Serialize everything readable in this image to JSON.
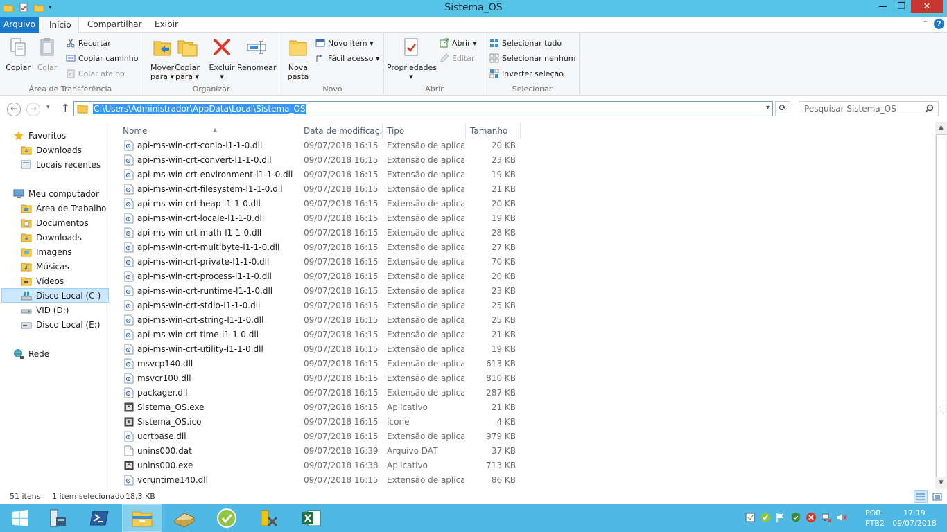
{
  "window": {
    "title": "Sistema_OS"
  },
  "tabs": [
    {
      "label": "Arquivo"
    },
    {
      "label": "Início"
    },
    {
      "label": "Compartilhar"
    },
    {
      "label": "Exibir"
    }
  ],
  "ribbon": {
    "clipboard": {
      "label": "Área de Transferência",
      "copy": "Copiar",
      "paste": "Colar",
      "cut": "Recortar",
      "copy_path": "Copiar caminho",
      "paste_shortcut": "Colar atalho"
    },
    "organize": {
      "label": "Organizar",
      "move_to_1": "Mover",
      "move_to_2": "para ▾",
      "copy_to_1": "Copiar",
      "copy_to_2": "para ▾",
      "delete_1": "Excluir",
      "delete_2": "▾",
      "rename": "Renomear"
    },
    "new": {
      "label": "Novo",
      "new_folder_1": "Nova",
      "new_folder_2": "pasta",
      "new_item": "Novo item ▾",
      "easy_access": "Fácil acesso ▾"
    },
    "open": {
      "label": "Abrir",
      "properties_1": "Propriedades",
      "properties_2": "▾",
      "open": "Abrir ▾",
      "edit": "Editar"
    },
    "select": {
      "label": "Selecionar",
      "select_all": "Selecionar tudo",
      "select_none": "Selecionar nenhum",
      "invert": "Inverter seleção"
    }
  },
  "address": {
    "path": "C:\\Users\\Administrador\\AppData\\Local\\Sistema_OS",
    "search_placeholder": "Pesquisar Sistema_OS"
  },
  "nav": {
    "favorites": "Favoritos",
    "downloads_fav": "Downloads",
    "recent": "Locais recentes",
    "computer": "Meu computador",
    "desktop": "Área de Trabalho",
    "documents": "Documentos",
    "downloads": "Downloads",
    "images": "Imagens",
    "music": "Músicas",
    "videos": "Vídeos",
    "disk_c": "Disco Local (C:)",
    "vid_d": "VID (D:)",
    "disk_e": "Disco Local (E:)",
    "network": "Rede"
  },
  "columns": {
    "name": "Nome",
    "date": "Data de modificaç...",
    "type": "Tipo",
    "size": "Tamanho"
  },
  "files": [
    {
      "name": "api-ms-win-crt-conio-l1-1-0.dll",
      "date": "09/07/2018 16:15",
      "type": "Extensão de aplica...",
      "size": "20 KB",
      "icon": "dll-icon"
    },
    {
      "name": "api-ms-win-crt-convert-l1-1-0.dll",
      "date": "09/07/2018 16:15",
      "type": "Extensão de aplica...",
      "size": "23 KB",
      "icon": "dll-icon"
    },
    {
      "name": "api-ms-win-crt-environment-l1-1-0.dll",
      "date": "09/07/2018 16:15",
      "type": "Extensão de aplica...",
      "size": "19 KB",
      "icon": "dll-icon"
    },
    {
      "name": "api-ms-win-crt-filesystem-l1-1-0.dll",
      "date": "09/07/2018 16:15",
      "type": "Extensão de aplica...",
      "size": "21 KB",
      "icon": "dll-icon"
    },
    {
      "name": "api-ms-win-crt-heap-l1-1-0.dll",
      "date": "09/07/2018 16:15",
      "type": "Extensão de aplica...",
      "size": "20 KB",
      "icon": "dll-icon"
    },
    {
      "name": "api-ms-win-crt-locale-l1-1-0.dll",
      "date": "09/07/2018 16:15",
      "type": "Extensão de aplica...",
      "size": "19 KB",
      "icon": "dll-icon"
    },
    {
      "name": "api-ms-win-crt-math-l1-1-0.dll",
      "date": "09/07/2018 16:15",
      "type": "Extensão de aplica...",
      "size": "28 KB",
      "icon": "dll-icon"
    },
    {
      "name": "api-ms-win-crt-multibyte-l1-1-0.dll",
      "date": "09/07/2018 16:15",
      "type": "Extensão de aplica...",
      "size": "27 KB",
      "icon": "dll-icon"
    },
    {
      "name": "api-ms-win-crt-private-l1-1-0.dll",
      "date": "09/07/2018 16:15",
      "type": "Extensão de aplica...",
      "size": "70 KB",
      "icon": "dll-icon"
    },
    {
      "name": "api-ms-win-crt-process-l1-1-0.dll",
      "date": "09/07/2018 16:15",
      "type": "Extensão de aplica...",
      "size": "20 KB",
      "icon": "dll-icon"
    },
    {
      "name": "api-ms-win-crt-runtime-l1-1-0.dll",
      "date": "09/07/2018 16:15",
      "type": "Extensão de aplica...",
      "size": "23 KB",
      "icon": "dll-icon"
    },
    {
      "name": "api-ms-win-crt-stdio-l1-1-0.dll",
      "date": "09/07/2018 16:15",
      "type": "Extensão de aplica...",
      "size": "25 KB",
      "icon": "dll-icon"
    },
    {
      "name": "api-ms-win-crt-string-l1-1-0.dll",
      "date": "09/07/2018 16:15",
      "type": "Extensão de aplica...",
      "size": "25 KB",
      "icon": "dll-icon"
    },
    {
      "name": "api-ms-win-crt-time-l1-1-0.dll",
      "date": "09/07/2018 16:15",
      "type": "Extensão de aplica...",
      "size": "21 KB",
      "icon": "dll-icon"
    },
    {
      "name": "api-ms-win-crt-utility-l1-1-0.dll",
      "date": "09/07/2018 16:15",
      "type": "Extensão de aplica...",
      "size": "19 KB",
      "icon": "dll-icon"
    },
    {
      "name": "msvcp140.dll",
      "date": "09/07/2018 16:15",
      "type": "Extensão de aplica...",
      "size": "613 KB",
      "icon": "dll-icon"
    },
    {
      "name": "msvcr100.dll",
      "date": "09/07/2018 16:15",
      "type": "Extensão de aplica...",
      "size": "810 KB",
      "icon": "dll-icon"
    },
    {
      "name": "packager.dll",
      "date": "09/07/2018 16:15",
      "type": "Extensão de aplica...",
      "size": "287 KB",
      "icon": "dll-icon"
    },
    {
      "name": "Sistema_OS.exe",
      "date": "09/07/2018 16:15",
      "type": "Aplicativo",
      "size": "21 KB",
      "icon": "exe-icon"
    },
    {
      "name": "Sistema_OS.ico",
      "date": "09/07/2018 16:15",
      "type": "Ícone",
      "size": "4 KB",
      "icon": "ico-icon"
    },
    {
      "name": "ucrtbase.dll",
      "date": "09/07/2018 16:15",
      "type": "Extensão de aplica...",
      "size": "979 KB",
      "icon": "dll-icon"
    },
    {
      "name": "unins000.dat",
      "date": "09/07/2018 16:39",
      "type": "Arquivo DAT",
      "size": "37 KB",
      "icon": "blank-file-icon"
    },
    {
      "name": "unins000.exe",
      "date": "09/07/2018 16:38",
      "type": "Aplicativo",
      "size": "713 KB",
      "icon": "exe-icon"
    },
    {
      "name": "vcruntime140.dll",
      "date": "09/07/2018 16:15",
      "type": "Extensão de aplica...",
      "size": "86 KB",
      "icon": "dll-icon"
    }
  ],
  "status": {
    "count": "51 itens",
    "selected": "1 item selecionado",
    "size": "18,3 KB"
  },
  "taskbar": {
    "lang_1": "POR",
    "lang_2": "PTB2",
    "time": "17:19",
    "date": "09/07/2018"
  },
  "colors": {
    "titlebar": "#55c4e6",
    "file_tab": "#1979ca",
    "selection": "#3399ff",
    "taskbar": "#4fb8e4",
    "close": "#c7372f"
  }
}
